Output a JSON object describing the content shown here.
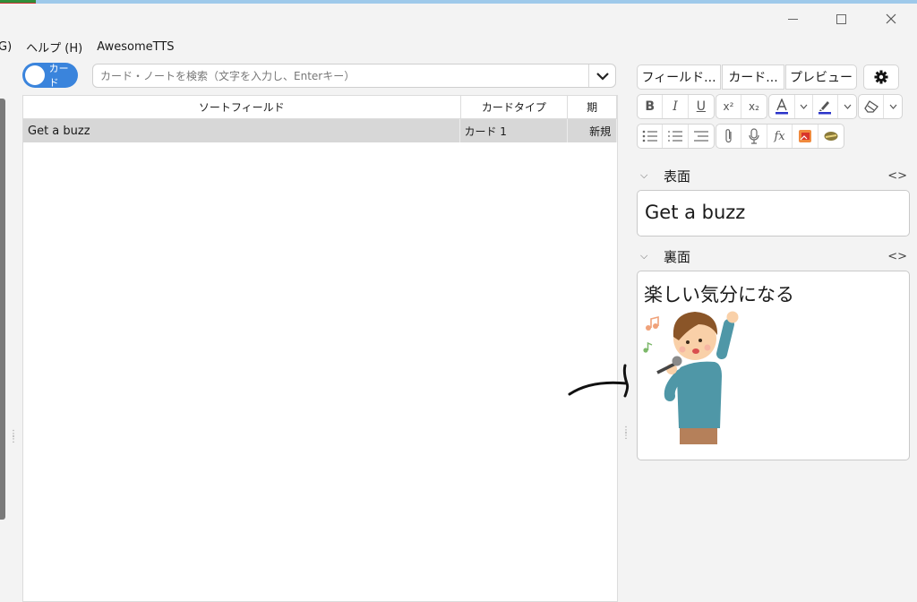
{
  "window": {
    "minimize_icon": "minimize-icon",
    "maximize_icon": "maximize-icon",
    "close_icon": "close-icon"
  },
  "menubar": {
    "items": [
      "G)",
      "ヘルプ (H)",
      "AwesomeTTS"
    ]
  },
  "toggle": {
    "label": "カード"
  },
  "search": {
    "placeholder": "カード・ノートを検索（文字を入力し、Enterキー）",
    "value": ""
  },
  "table": {
    "columns": [
      "ソートフィールド",
      "カードタイプ",
      "期"
    ],
    "rows": [
      {
        "sort_field": "Get a buzz",
        "card_type": "カード 1",
        "due": "新規"
      }
    ]
  },
  "editor": {
    "tabs": [
      "フィールド...",
      "カード...",
      "プレビュー"
    ],
    "settings_icon": "gear-icon",
    "format_row1": [
      {
        "label": "B",
        "icon": "bold-icon"
      },
      {
        "label": "I",
        "icon": "italic-icon"
      },
      {
        "label": "U",
        "icon": "underline-icon"
      },
      {
        "label": "x²",
        "icon": "superscript-icon"
      },
      {
        "label": "x₂",
        "icon": "subscript-icon"
      }
    ],
    "text_color": "#2b34c9",
    "highlight_color": "#2b34c9",
    "fields": [
      {
        "name": "表面",
        "value": "Get a buzz"
      },
      {
        "name": "裏面",
        "value": "楽しい気分になる"
      }
    ],
    "code_toggle": "<>"
  },
  "colors": {
    "accent": "#3a84dc",
    "selected_row": "#d7d7d7"
  }
}
